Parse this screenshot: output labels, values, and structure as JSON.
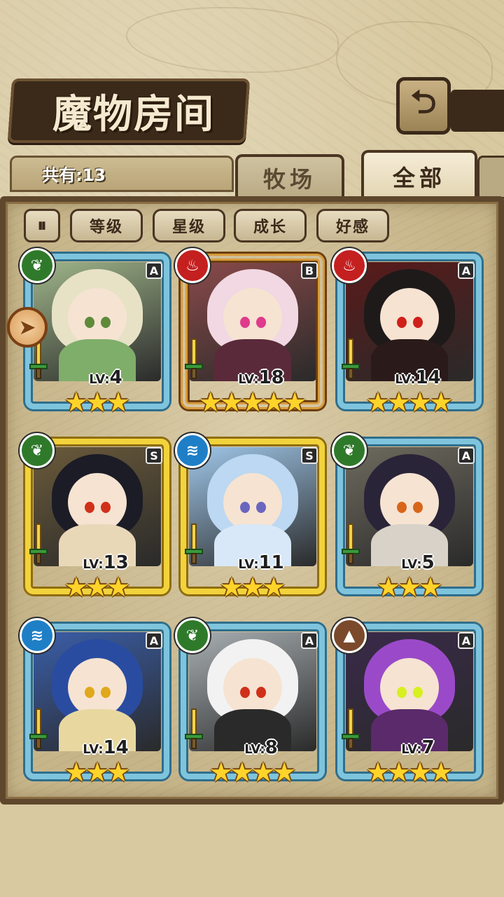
{
  "header": {
    "title": "魔物房间",
    "back_icon": "back-arrow-icon"
  },
  "info": {
    "count_label": "共有:13"
  },
  "tabs": [
    {
      "label": "牧场",
      "active": false
    },
    {
      "label": "全部",
      "active": true
    }
  ],
  "sort_buttons": [
    "等级",
    "星级",
    "成长",
    "好感"
  ],
  "pause_icon": "pause-icon",
  "colors": {
    "leaf": "#2f7a2a",
    "fire": "#c42020",
    "water": "#1e7fc7",
    "earth": "#7b4a2c",
    "frame_blue": "#7fc4dd",
    "frame_gold": "#f2d33c",
    "frame_bronze": "#d79a3c"
  },
  "monsters": [
    {
      "element": "leaf",
      "rank": "A",
      "level": "4",
      "stars": 3
    },
    {
      "element": "fire",
      "rank": "B",
      "level": "18",
      "stars": 5
    },
    {
      "element": "fire",
      "rank": "A",
      "level": "14",
      "stars": 4
    },
    {
      "element": "leaf",
      "rank": "S",
      "level": "13",
      "stars": 3
    },
    {
      "element": "water",
      "rank": "S",
      "level": "11",
      "stars": 3
    },
    {
      "element": "leaf",
      "rank": "A",
      "level": "5",
      "stars": 3
    },
    {
      "element": "water",
      "rank": "A",
      "level": "14",
      "stars": 3
    },
    {
      "element": "leaf",
      "rank": "A",
      "level": "8",
      "stars": 4
    },
    {
      "element": "earth",
      "rank": "A",
      "level": "7",
      "stars": 4
    }
  ],
  "lv_prefix": "LV:"
}
